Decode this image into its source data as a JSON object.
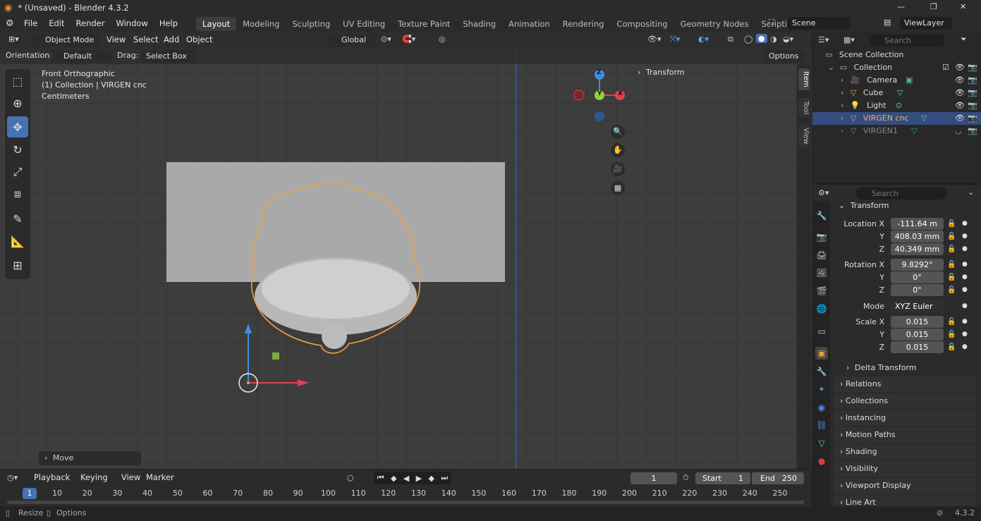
{
  "window": {
    "title": "* (Unsaved) - Blender 4.3.2",
    "controls": [
      "—",
      "❐",
      "✕"
    ]
  },
  "menu": [
    "File",
    "Edit",
    "Render",
    "Window",
    "Help"
  ],
  "workspaces": [
    {
      "label": "Layout"
    },
    {
      "label": "Modeling"
    },
    {
      "label": "Sculpting"
    },
    {
      "label": "UV Editing"
    },
    {
      "label": "Texture Paint"
    },
    {
      "label": "Shading"
    },
    {
      "label": "Animation"
    },
    {
      "label": "Rendering"
    },
    {
      "label": "Compositing"
    },
    {
      "label": "Geometry Nodes"
    },
    {
      "label": "Scripting"
    }
  ],
  "add_workspace": "+",
  "scene": "Scene",
  "view_layer": "ViewLayer",
  "viewport_header": {
    "mode": "Object Mode",
    "menus": [
      "View",
      "Select",
      "Add",
      "Object"
    ],
    "transform_orientation": "Global"
  },
  "tool_header": {
    "orientation_label": "Orientation:",
    "orientation_value": "Default",
    "drag_label": "Drag:",
    "drag_value": "Select Box",
    "options": "Options"
  },
  "overlay_text": {
    "view": "Front Orthographic",
    "collection": "(1) Collection | VIRGEN cnc",
    "units": "Centimeters"
  },
  "n_panel": {
    "title": "Transform",
    "tabs": [
      "Item",
      "Tool",
      "View"
    ]
  },
  "gizmo": {
    "z": "Z",
    "y": "Y",
    "x": "X"
  },
  "last_operator": "Move",
  "outliner": {
    "search_placeholder": "Search",
    "scene_collection": "Scene Collection",
    "collection": "Collection",
    "items": [
      {
        "name": "Camera"
      },
      {
        "name": "Cube"
      },
      {
        "name": "Light"
      },
      {
        "name": "VIRGEN cnc"
      },
      {
        "name": "VIRGEN1"
      }
    ]
  },
  "properties": {
    "search_placeholder": "Search",
    "panel": "Transform",
    "location_label": "Location X",
    "location": {
      "x": "-111.64 m",
      "y": "408.03 mm",
      "z": "40.349 mm"
    },
    "rotation_label": "Rotation X",
    "rotation": {
      "x": "9.8292°",
      "y": "0°",
      "z": "0°"
    },
    "mode_label": "Mode",
    "mode": "XYZ Euler",
    "scale_label": "Scale X",
    "scale": {
      "x": "0.015",
      "y": "0.015",
      "z": "0.015"
    },
    "y_label": "Y",
    "z_label": "Z",
    "delta": "Delta Transform",
    "sections": [
      "Relations",
      "Collections",
      "Instancing",
      "Motion Paths",
      "Shading",
      "Visibility",
      "Viewport Display",
      "Line Art"
    ]
  },
  "timeline": {
    "menus": [
      "Playback",
      "Keying",
      "View",
      "Marker"
    ],
    "current_frame": "1",
    "start_label": "Start",
    "start": "1",
    "end_label": "End",
    "end": "250",
    "ruler": [
      "1",
      "10",
      "20",
      "30",
      "40",
      "50",
      "60",
      "70",
      "80",
      "90",
      "100",
      "110",
      "120",
      "130",
      "140",
      "150",
      "160",
      "170",
      "180",
      "190",
      "200",
      "210",
      "220",
      "230",
      "240",
      "250"
    ]
  },
  "status": {
    "left1": "Resize",
    "left2": "Options",
    "version": "4.3.2"
  },
  "colors": {
    "accent": "#4772b3",
    "selection_outline": "#f0a040",
    "x_axis": "#e0404e",
    "y_axis": "#8fd23a",
    "z_axis": "#3f8ee0"
  }
}
